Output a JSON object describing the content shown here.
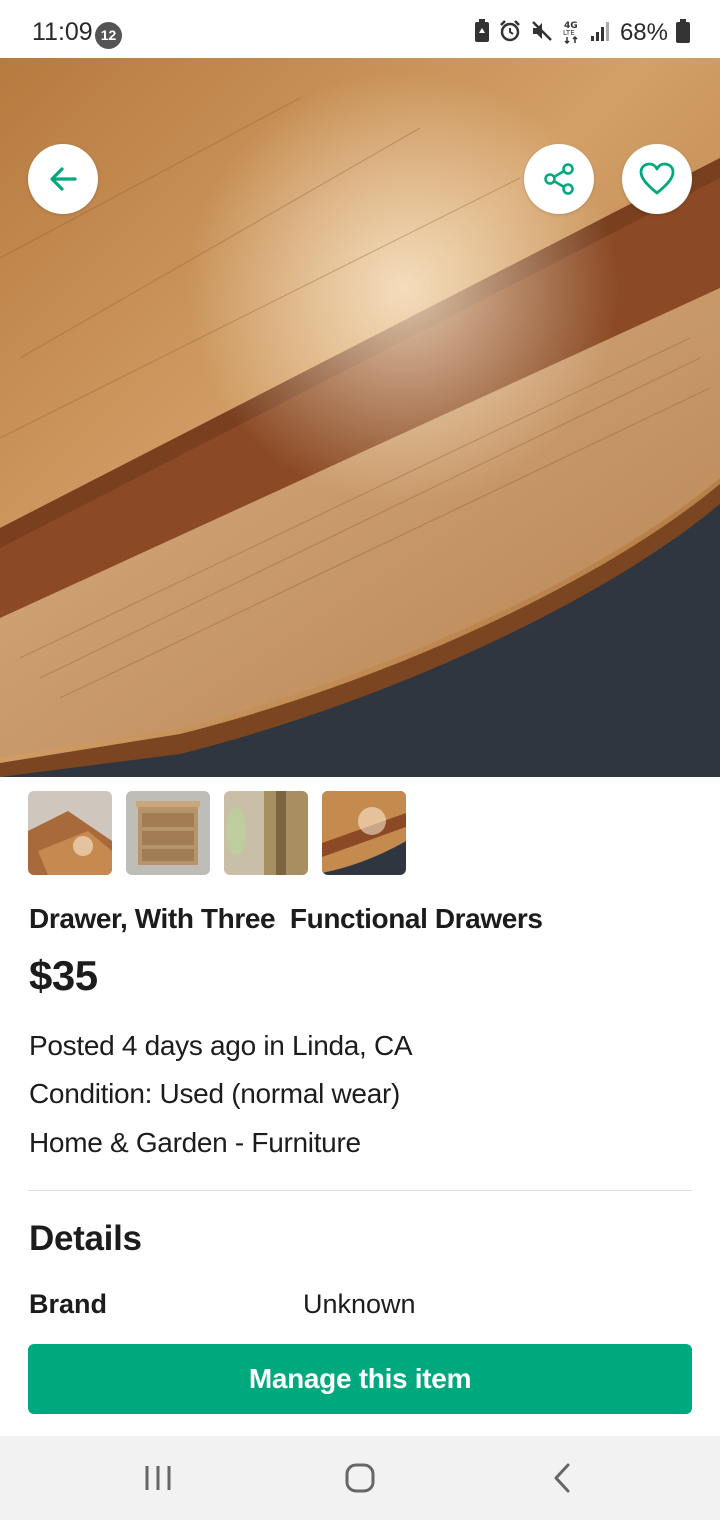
{
  "status_bar": {
    "time": "11:09",
    "notification_count": "12",
    "battery_percent": "68%",
    "icons": [
      "battery-saver-icon",
      "alarm-icon",
      "mute-icon",
      "4g-lte-icon",
      "signal-icon",
      "battery-icon"
    ]
  },
  "hero": {
    "photo": "wood-table-edge-photo",
    "back_icon": "back-arrow-icon",
    "share_icon": "share-icon",
    "favorite_icon": "heart-icon"
  },
  "thumbnails": [
    {
      "name": "thumbnail-1"
    },
    {
      "name": "thumbnail-2"
    },
    {
      "name": "thumbnail-3"
    },
    {
      "name": "thumbnail-4"
    }
  ],
  "listing": {
    "title": "Drawer, With Three  Functional Drawers",
    "price": "$35",
    "posted": "Posted 4 days ago in Linda, CA",
    "condition": "Condition: Used (normal wear)",
    "category": "Home & Garden - Furniture"
  },
  "details": {
    "heading": "Details",
    "rows": [
      {
        "key": "Brand",
        "value": "Unknown"
      }
    ]
  },
  "actions": {
    "manage_label": "Manage this item"
  },
  "colors": {
    "accent": "#00a87e",
    "icon_green": "#00a87e",
    "nav_bg": "#f2f2f2"
  },
  "nav_bar": {
    "icons": [
      "recents-icon",
      "home-icon",
      "back-icon"
    ]
  }
}
